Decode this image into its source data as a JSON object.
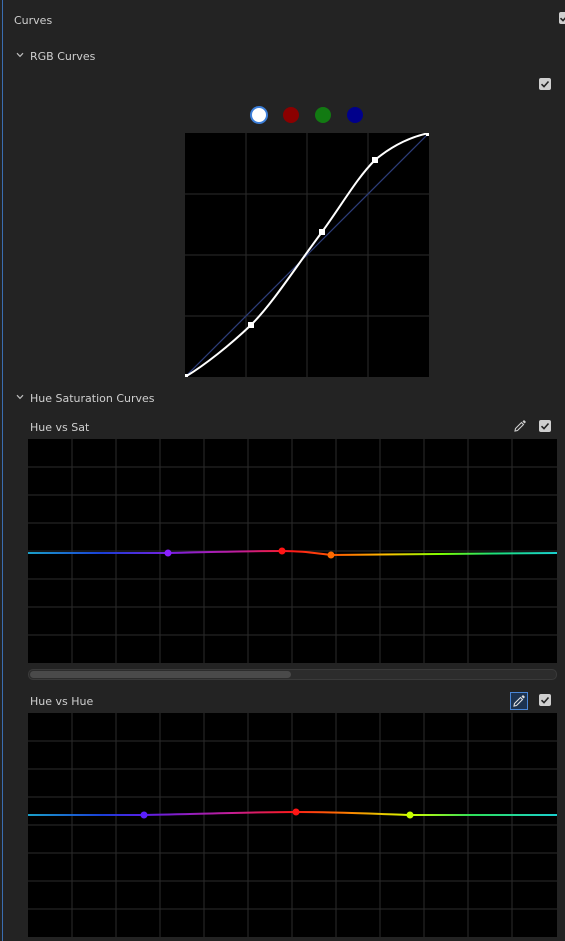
{
  "panel": {
    "title": "Curves",
    "rgb_section": {
      "label": "RGB Curves"
    },
    "hue_section": {
      "label": "Hue Saturation Curves"
    },
    "hue_vs_sat": {
      "label": "Hue vs Sat"
    },
    "hue_vs_hue": {
      "label": "Hue vs Hue"
    }
  },
  "channels": [
    {
      "name": "white",
      "color": "#ffffff",
      "selected": true
    },
    {
      "name": "red",
      "color": "#8b0000",
      "selected": false
    },
    {
      "name": "green",
      "color": "#127a12",
      "selected": false
    },
    {
      "name": "blue",
      "color": "#00008b",
      "selected": false
    }
  ],
  "colors": {
    "accent": "#3a6db0",
    "background": "#232323",
    "graph_bg": "#000000",
    "grid": "#2b2b2b",
    "checkbox": "#cfcfcf",
    "control_point": "#ffffff",
    "hue_points": [
      "#8a1fff",
      "#ff1515",
      "#ff6a00",
      "#c8ff00"
    ]
  },
  "icons": {
    "collapse": "chevron-down-icon",
    "enable": "checkmark-icon",
    "eyedropper": "eyedropper-icon"
  },
  "rgb_curve": {
    "control_points": [
      [
        0,
        0
      ],
      [
        0.27,
        0.21
      ],
      [
        0.57,
        0.59
      ],
      [
        0.78,
        0.89
      ],
      [
        1,
        1
      ]
    ]
  },
  "hue_vs_sat_curve": {
    "scroll_fraction": 0.5
  }
}
